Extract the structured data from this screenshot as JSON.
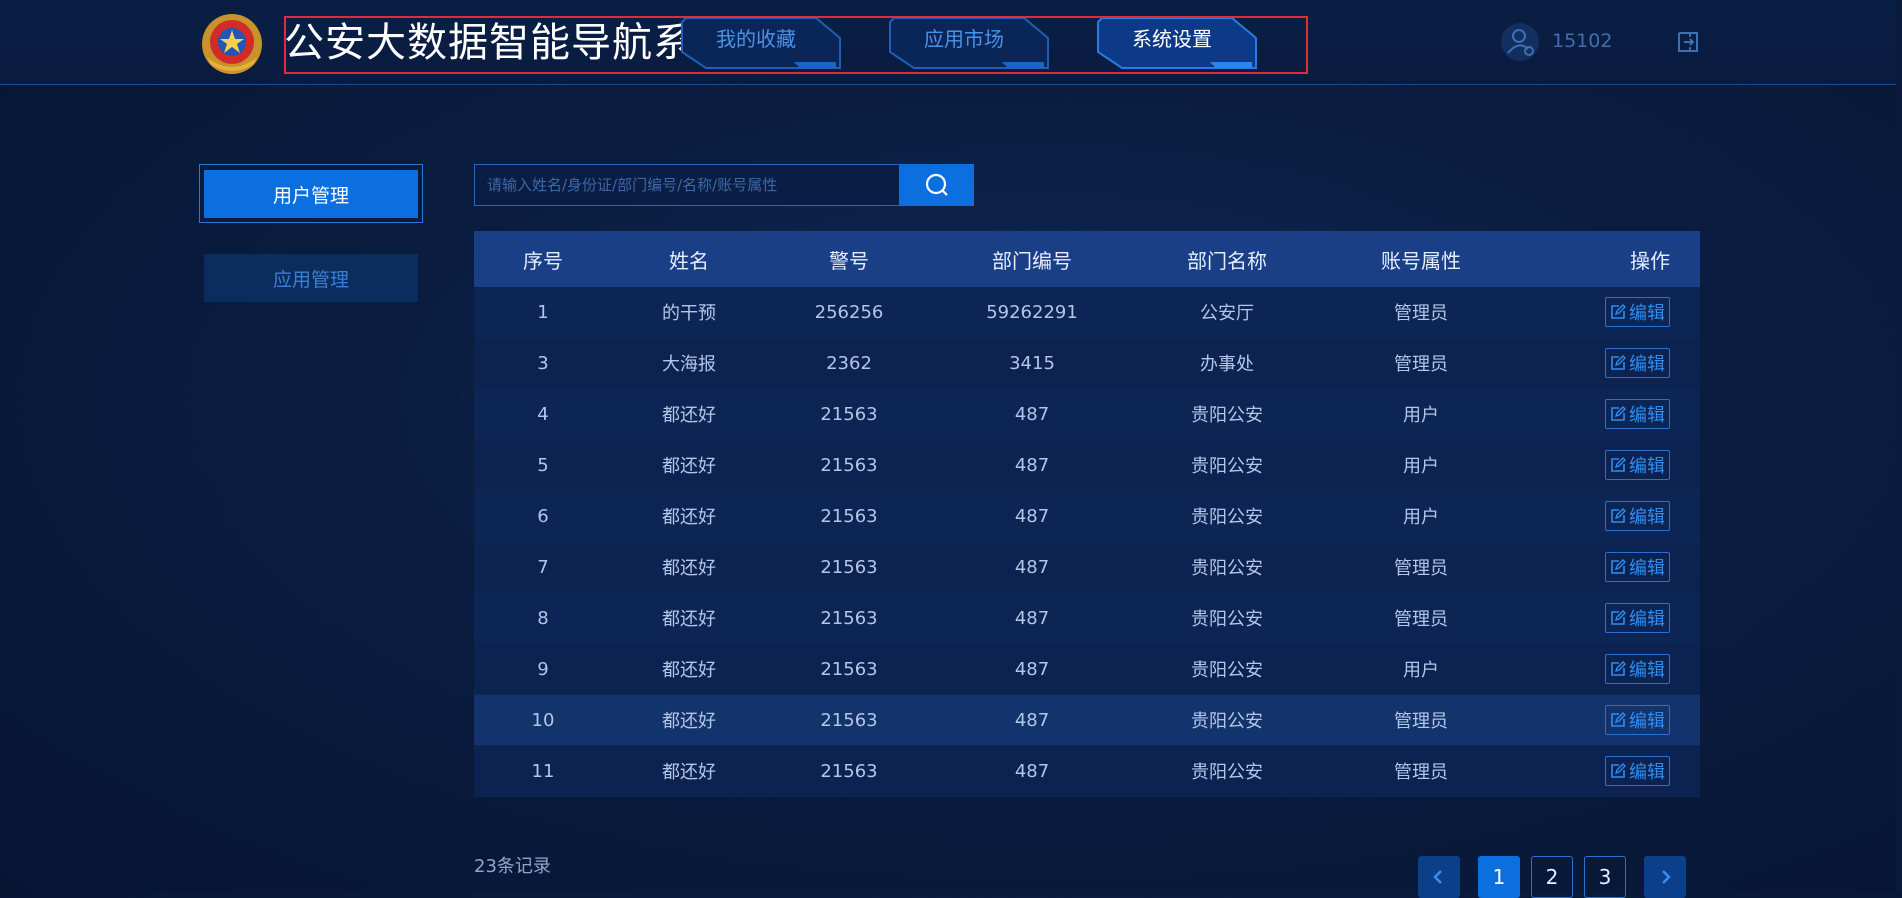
{
  "header": {
    "title": "公安大数据智能导航系统",
    "nav": [
      {
        "label": "我的收藏",
        "active": false
      },
      {
        "label": "应用市场",
        "active": false
      },
      {
        "label": "系统设置",
        "active": true
      }
    ],
    "user": {
      "name": "15102"
    }
  },
  "sidebar": {
    "items": [
      {
        "label": "用户管理",
        "active": true
      },
      {
        "label": "应用管理",
        "active": false
      }
    ]
  },
  "search": {
    "placeholder": "请输入姓名/身份证/部门编号/名称/账号属性"
  },
  "table": {
    "columns": [
      "序号",
      "姓名",
      "警号",
      "部门编号",
      "部门名称",
      "账号属性",
      "操作"
    ],
    "edit_label": "编辑",
    "rows": [
      [
        "1",
        "的干预",
        "256256",
        "59262291",
        "公安厅",
        "管理员"
      ],
      [
        "3",
        "大海报",
        "2362",
        "3415",
        "办事处",
        "管理员"
      ],
      [
        "4",
        "都还好",
        "21563",
        "487",
        "贵阳公安",
        "用户"
      ],
      [
        "5",
        "都还好",
        "21563",
        "487",
        "贵阳公安",
        "用户"
      ],
      [
        "6",
        "都还好",
        "21563",
        "487",
        "贵阳公安",
        "用户"
      ],
      [
        "7",
        "都还好",
        "21563",
        "487",
        "贵阳公安",
        "管理员"
      ],
      [
        "8",
        "都还好",
        "21563",
        "487",
        "贵阳公安",
        "管理员"
      ],
      [
        "9",
        "都还好",
        "21563",
        "487",
        "贵阳公安",
        "用户"
      ],
      [
        "10",
        "都还好",
        "21563",
        "487",
        "贵阳公安",
        "管理员"
      ],
      [
        "11",
        "都还好",
        "21563",
        "487",
        "贵阳公安",
        "管理员"
      ]
    ]
  },
  "footer": {
    "records": "23条记录",
    "pages": [
      "1",
      "2",
      "3"
    ],
    "current_page": "1"
  },
  "colors": {
    "accent": "#0c6fe0",
    "highlight_border": "#e02b3a",
    "table_header": "#1a3f86"
  }
}
